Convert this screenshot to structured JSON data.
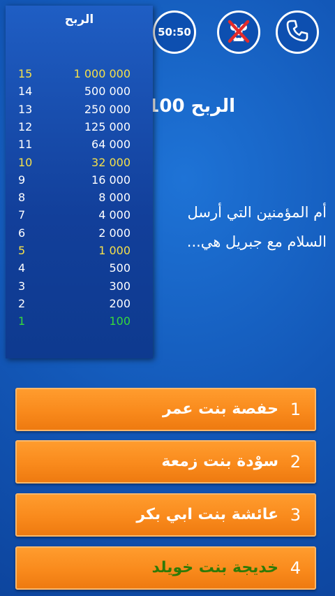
{
  "lifelines": {
    "fifty_fifty_label": "50:50",
    "audience_icon": "audience-x-icon",
    "phone_icon": "phone-icon"
  },
  "question_panel": {
    "prize_title": "الربح 100",
    "question_line1": "أم المؤمنين التي أرسل",
    "question_line2": "السلام مع جبريل هي..."
  },
  "ladder": {
    "title": "الربح",
    "rows": [
      {
        "level": "15",
        "amount": "1 000 000",
        "color": "#f5e04a"
      },
      {
        "level": "14",
        "amount": "500 000",
        "color": "#ffffff"
      },
      {
        "level": "13",
        "amount": "250 000",
        "color": "#ffffff"
      },
      {
        "level": "12",
        "amount": "125 000",
        "color": "#ffffff"
      },
      {
        "level": "11",
        "amount": "64 000",
        "color": "#ffffff"
      },
      {
        "level": "10",
        "amount": "32 000",
        "color": "#f5e04a"
      },
      {
        "level": "9",
        "amount": "16 000",
        "color": "#ffffff"
      },
      {
        "level": "8",
        "amount": "8 000",
        "color": "#ffffff"
      },
      {
        "level": "7",
        "amount": "4 000",
        "color": "#ffffff"
      },
      {
        "level": "6",
        "amount": "2 000",
        "color": "#ffffff"
      },
      {
        "level": "5",
        "amount": "1 000",
        "color": "#f5e04a"
      },
      {
        "level": "4",
        "amount": "500",
        "color": "#ffffff"
      },
      {
        "level": "3",
        "amount": "300",
        "color": "#ffffff"
      },
      {
        "level": "2",
        "amount": "200",
        "color": "#ffffff"
      },
      {
        "level": "1",
        "amount": "100",
        "color": "#37d93b"
      }
    ]
  },
  "answers": [
    {
      "number": "1",
      "label": "حفصة بنت عمر",
      "color": "#ffffff"
    },
    {
      "number": "2",
      "label": "سوْدة بنت زمعة",
      "color": "#ffffff"
    },
    {
      "number": "3",
      "label": "عائشة بنت ابي بكر",
      "color": "#ffffff"
    },
    {
      "number": "4",
      "label": "خديجة بنت خويلد",
      "color": "#2f7a07"
    }
  ]
}
